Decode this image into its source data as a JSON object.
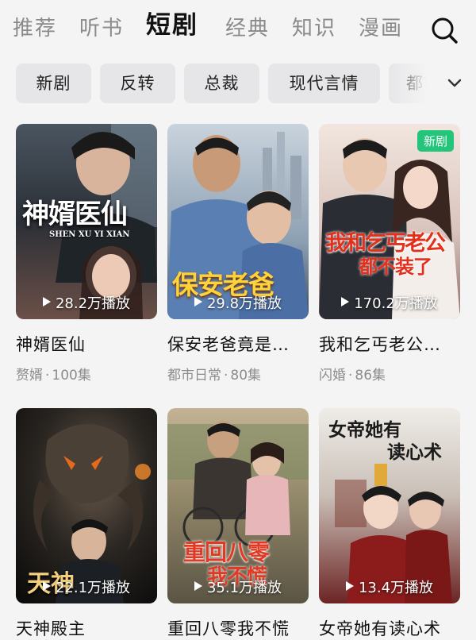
{
  "top_tabs": [
    {
      "label": "推荐",
      "active": false
    },
    {
      "label": "听书",
      "active": false
    },
    {
      "label": "短剧",
      "active": true
    },
    {
      "label": "经典",
      "active": false
    },
    {
      "label": "知识",
      "active": false
    },
    {
      "label": "漫画",
      "active": false
    }
  ],
  "search_icon": "search-icon",
  "filter_chips": [
    "新剧",
    "反转",
    "总裁",
    "现代言情",
    "都市"
  ],
  "more_icon": "chevron-down-icon",
  "dramas": [
    {
      "title": "神婿医仙",
      "tag": "赘婿",
      "episodes": "100集",
      "plays": "28.2万播放",
      "poster_text": "神婿医仙",
      "poster_sub": "SHEN XU YI XIAN",
      "badge": ""
    },
    {
      "title": "保安老爸竟是…",
      "tag": "都市日常",
      "episodes": "80集",
      "plays": "29.8万播放",
      "poster_text": "保安老爸",
      "poster_sub": "",
      "badge": ""
    },
    {
      "title": "我和乞丐老公…",
      "tag": "闪婚",
      "episodes": "86集",
      "plays": "170.2万播放",
      "poster_text": "我和乞丐老公",
      "poster_sub": "都不装了",
      "badge": "新剧"
    },
    {
      "title": "天神殿主",
      "tag": "",
      "episodes": "",
      "plays": "22.1万播放",
      "poster_text": "天神",
      "poster_sub": "",
      "badge": ""
    },
    {
      "title": "重回八零我不慌",
      "tag": "",
      "episodes": "",
      "plays": "35.1万播放",
      "poster_text": "重回八零",
      "poster_sub": "我不慌",
      "badge": ""
    },
    {
      "title": "女帝她有读心术",
      "tag": "",
      "episodes": "",
      "plays": "13.4万播放",
      "poster_text": "女帝她有",
      "poster_sub": "读心术",
      "badge": ""
    }
  ],
  "colors": {
    "accent_green": "#22c57a",
    "active_tab": "#111111",
    "inactive_tab": "#8a8a8a"
  }
}
